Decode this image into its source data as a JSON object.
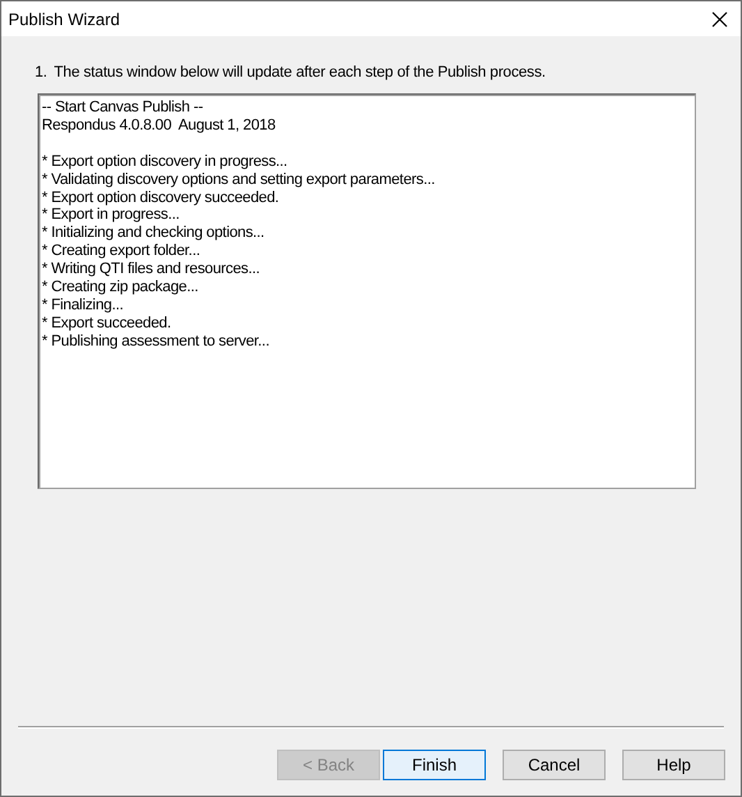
{
  "window": {
    "title": "Publish Wizard"
  },
  "instruction": {
    "number": "1.",
    "text": "The status window below will update after each step of the Publish process."
  },
  "status_log": {
    "header": [
      "-- Start Canvas Publish --",
      "Respondus 4.0.8.00  August 1, 2018"
    ],
    "steps": [
      "* Export option discovery in progress...",
      "* Validating discovery options and setting export parameters...",
      "* Export option discovery succeeded.",
      "* Export in progress...",
      "* Initializing and checking options...",
      "* Creating export folder...",
      "* Writing QTI files and resources...",
      "* Creating zip package...",
      "* Finalizing...",
      "* Export succeeded.",
      "* Publishing assessment to server..."
    ]
  },
  "buttons": [
    {
      "label": "< Back",
      "disabled": true,
      "default": false
    },
    {
      "label": "Finish",
      "disabled": false,
      "default": true
    },
    {
      "label": "Cancel",
      "disabled": false,
      "default": false
    },
    {
      "label": "Help",
      "disabled": false,
      "default": false
    }
  ]
}
